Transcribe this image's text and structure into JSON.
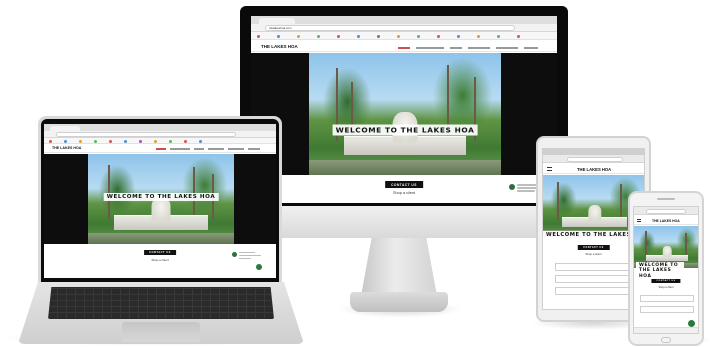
{
  "site": {
    "name": "THE LAKES HOA",
    "welcome": "WELCOME TO THE LAKES HOA",
    "contact_button": "CONTACT US",
    "shop_text": "Shop a client",
    "url": "thelakeshoa.com"
  },
  "colors": {
    "hero_overlay": "#ffffff",
    "nav_active": "#111111",
    "chat_avatar": "#2f6e3e",
    "device_frame": "#0a0a0a",
    "page_bg": "#ffffff"
  },
  "icons": {
    "chat": "chat-avatar-icon",
    "menu": "hamburger-menu-icon"
  }
}
